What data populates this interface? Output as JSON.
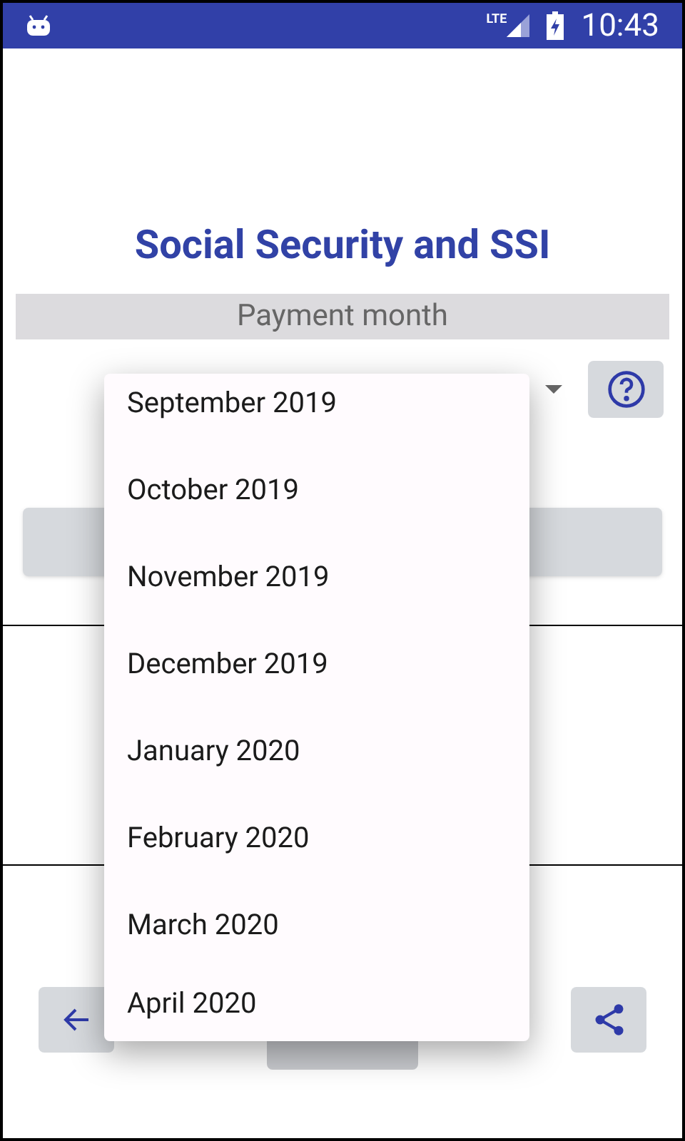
{
  "status_bar": {
    "time": "10:43",
    "network": "LTE"
  },
  "title": "Social Security and SSI",
  "section_header": "Payment month",
  "dropdown": {
    "items": [
      {
        "label": "September 2019"
      },
      {
        "label": "October 2019"
      },
      {
        "label": "November 2019"
      },
      {
        "label": "December 2019"
      },
      {
        "label": "January 2020"
      },
      {
        "label": "February 2020"
      },
      {
        "label": "March 2020"
      },
      {
        "label": "April 2020"
      }
    ]
  }
}
